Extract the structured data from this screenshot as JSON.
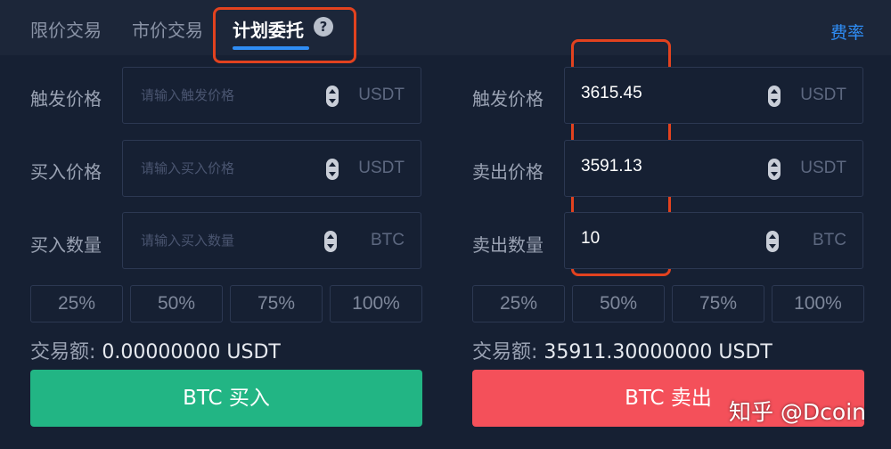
{
  "tabs": {
    "limit": "限价交易",
    "market": "市价交易",
    "plan": "计划委托",
    "help_glyph": "?",
    "fee": "费率"
  },
  "buy_panel": {
    "trigger_label": "触发价格",
    "trigger_placeholder": "请输入触发价格",
    "trigger_unit": "USDT",
    "price_label": "买入价格",
    "price_placeholder": "请输入买入价格",
    "price_unit": "USDT",
    "qty_label": "买入数量",
    "qty_placeholder": "请输入买入数量",
    "qty_unit": "BTC",
    "pct": [
      "25%",
      "50%",
      "75%",
      "100%"
    ],
    "amount_label": "交易额:",
    "amount_value": "0.00000000 USDT",
    "button": "BTC 买入"
  },
  "sell_panel": {
    "trigger_label": "触发价格",
    "trigger_value": "3615.45",
    "trigger_unit": "USDT",
    "price_label": "卖出价格",
    "price_value": "3591.13",
    "price_unit": "USDT",
    "qty_label": "卖出数量",
    "qty_value": "10",
    "qty_unit": "BTC",
    "pct": [
      "25%",
      "50%",
      "75%",
      "100%"
    ],
    "amount_label": "交易额:",
    "amount_value": "35911.30000000 USDT",
    "button": "BTC 卖出"
  },
  "watermark": "知乎 @Dcoin",
  "colors": {
    "background": "#162033",
    "accent": "#2f8df5",
    "buy": "#22b584",
    "sell": "#f4505a",
    "highlight": "#e2421f"
  }
}
